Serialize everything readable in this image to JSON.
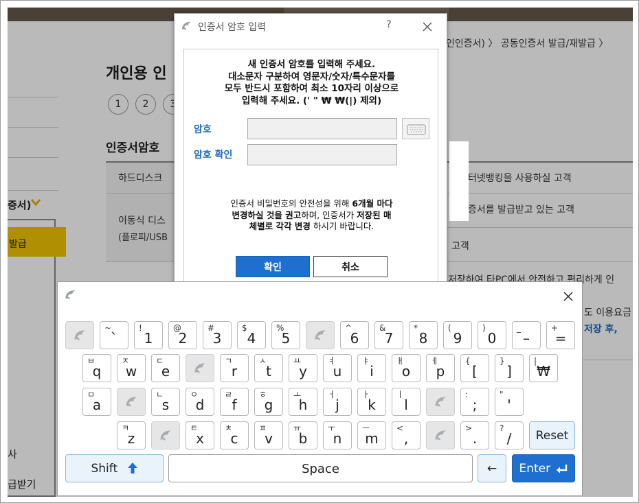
{
  "background": {
    "page_title": "개인용 인",
    "breadcrumb": "인인증서) 〉 공동인증서 발급/재발급 〉",
    "steps": [
      "1",
      "2",
      "3"
    ],
    "section_title": "인증서암호",
    "left_menu_label": "증서)",
    "left_menu_selected": "발급",
    "left_bottom_1": "사",
    "left_bottom_2": "급받기",
    "rows": [
      {
        "left": "하드디스크",
        "right": "터넷뱅킹을 사용하실 고객"
      },
      {
        "left": "이동식 디스",
        "left2": "(플로피/USB",
        "right": "증서를 발급받고 있는 고객"
      },
      {
        "left": "",
        "right": "고객"
      },
      {
        "left": "",
        "right": "저장하여 타PC에서 안전하고 편리하게 인"
      },
      {
        "left": "",
        "right": "도 이용요금",
        "right2": "저장 후,"
      }
    ]
  },
  "dialog": {
    "title": "인증서 암호 입력",
    "help": "?",
    "instructions": [
      "새 인증서 암호를 입력해 주세요.",
      "대소문자 구분하여 영문자/숫자/특수문자를",
      "모두 반드시 포함하여 최소 10자리 이상으로",
      "입력해 주세요. (' \" ₩ ₩(|) 제외)"
    ],
    "password_label": "암호",
    "confirm_label": "암호 확인",
    "password_value": "",
    "confirm_value": "",
    "notice_line1_pre": "인증서 비밀번호의 안전성을 위해 ",
    "notice_line1_bold": "6개월 마다",
    "notice_line2_bold1": "변경하실 것을 권고",
    "notice_line2_mid": "하며, 인증서가 ",
    "notice_line2_bold2": "저장된 매",
    "notice_line3_bold": "체별로 각각 변경",
    "notice_line3_post": " 하시기 바랍니다.",
    "ok_label": "확인",
    "cancel_label": "취소"
  },
  "keyboard": {
    "rows": [
      [
        {
          "blank": true
        },
        {
          "s": "~",
          "m": "`"
        },
        {
          "s": "!",
          "m": "1"
        },
        {
          "s": "@",
          "m": "2"
        },
        {
          "s": "#",
          "m": "3"
        },
        {
          "s": "$",
          "m": "4"
        },
        {
          "s": "%",
          "m": "5"
        },
        {
          "blank": true
        },
        {
          "s": "^",
          "m": "6"
        },
        {
          "s": "&",
          "m": "7"
        },
        {
          "s": "*",
          "m": "8"
        },
        {
          "s": "(",
          "m": "9"
        },
        {
          "s": ")",
          "m": "0"
        },
        {
          "s": "_",
          "m": "–"
        },
        {
          "s": "+",
          "m": "="
        }
      ],
      [
        {
          "s": "ㅂ",
          "m": "q"
        },
        {
          "s": "ㅈ",
          "m": "w"
        },
        {
          "s": "ㄷ",
          "m": "e"
        },
        {
          "blank": true
        },
        {
          "s": "ㄱ",
          "m": "r"
        },
        {
          "s": "ㅅ",
          "m": "t"
        },
        {
          "s": "ㅛ",
          "m": "y"
        },
        {
          "s": "ㅕ",
          "m": "u"
        },
        {
          "s": "ㅑ",
          "m": "i"
        },
        {
          "s": "ㅐ",
          "m": "o"
        },
        {
          "s": "ㅔ",
          "m": "p"
        },
        {
          "s": "{",
          "m": "["
        },
        {
          "s": "}",
          "m": "]"
        },
        {
          "s": "|",
          "m": "₩"
        }
      ],
      [
        {
          "s": "ㅁ",
          "m": "a"
        },
        {
          "blank": true
        },
        {
          "s": "ㄴ",
          "m": "s"
        },
        {
          "s": "ㅇ",
          "m": "d"
        },
        {
          "s": "ㄹ",
          "m": "f"
        },
        {
          "s": "ㅎ",
          "m": "g"
        },
        {
          "s": "ㅗ",
          "m": "h"
        },
        {
          "s": "ㅓ",
          "m": "j"
        },
        {
          "s": "ㅏ",
          "m": "k"
        },
        {
          "s": "ㅣ",
          "m": "l"
        },
        {
          "blank": true
        },
        {
          "s": ":",
          "m": ";"
        },
        {
          "s": "\"",
          "m": "'"
        }
      ],
      [
        {
          "s": "ㅋ",
          "m": "z"
        },
        {
          "blank": true
        },
        {
          "s": "ㅌ",
          "m": "x"
        },
        {
          "s": "ㅊ",
          "m": "c"
        },
        {
          "s": "ㅍ",
          "m": "v"
        },
        {
          "s": "ㅠ",
          "m": "b"
        },
        {
          "s": "ㅜ",
          "m": "n"
        },
        {
          "s": "ㅡ",
          "m": "m"
        },
        {
          "s": "<",
          "m": ","
        },
        {
          "blank": true
        },
        {
          "s": ">",
          "m": "."
        },
        {
          "s": "?",
          "m": "/"
        }
      ]
    ],
    "reset_label": "Reset",
    "shift_label": "Shift",
    "space_label": "Space",
    "backspace_label": "←",
    "enter_label": "Enter"
  }
}
